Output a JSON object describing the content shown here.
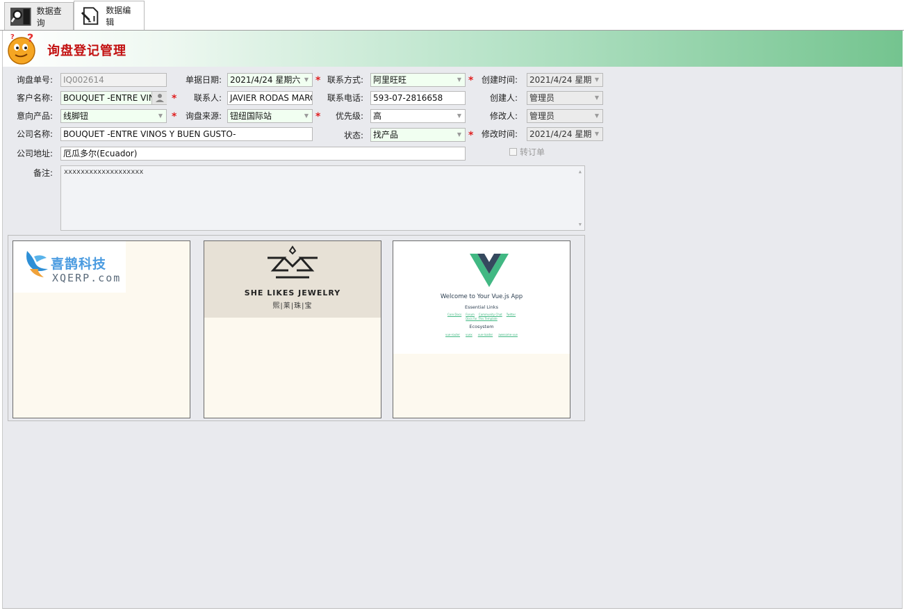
{
  "tabs": [
    {
      "label": "数据查询",
      "icon": "search-icon"
    },
    {
      "label": "数据编辑",
      "icon": "edit-document-icon"
    }
  ],
  "banner": {
    "title": "询盘登记管理"
  },
  "form": {
    "inquiry_no": {
      "label": "询盘单号:",
      "value": "IQ002614"
    },
    "doc_date": {
      "label": "单据日期:",
      "value": "2021/4/24 星期六"
    },
    "contact_method": {
      "label": "联系方式:",
      "value": "阿里旺旺"
    },
    "create_time": {
      "label": "创建时间:",
      "value": "2021/4/24 星期"
    },
    "customer": {
      "label": "客户名称:",
      "value": "BOUQUET -ENTRE VIN"
    },
    "contact_person": {
      "label": "联系人:",
      "value": "JAVIER RODAS MARC"
    },
    "contact_phone": {
      "label": "联系电话:",
      "value": "593-07-2816658"
    },
    "creator": {
      "label": "创建人:",
      "value": "管理员"
    },
    "product": {
      "label": "意向产品:",
      "value": "线脚钮"
    },
    "source": {
      "label": "询盘来源:",
      "value": "钮纽国际站"
    },
    "priority": {
      "label": "优先级:",
      "value": "高"
    },
    "modifier": {
      "label": "修改人:",
      "value": "管理员"
    },
    "company": {
      "label": "公司名称:",
      "value": "BOUQUET -ENTRE VINOS Y BUEN GUSTO-"
    },
    "status": {
      "label": "状态:",
      "value": "找产品"
    },
    "modify_time": {
      "label": "修改时间:",
      "value": "2021/4/24 星期"
    },
    "address": {
      "label": "公司地址:",
      "value": "厄瓜多尔(Ecuador)"
    },
    "convert_order": {
      "label": "转订单",
      "checked": false
    },
    "remark": {
      "label": "备注:",
      "value": "xxxxxxxxxxxxxxxxxxx"
    }
  },
  "images": [
    {
      "brand": "喜鹊科技",
      "sub": "XQERP.com"
    },
    {
      "brand": "SHE LIKES JEWELRY",
      "sub": "熙|莱|珠|宝"
    },
    {
      "title": "Welcome to Your Vue.js App",
      "section1": "Essential Links",
      "links1": [
        "Core Docs",
        "Forum",
        "Community Chat",
        "Twitter"
      ],
      "link_extra": "Docs for This Template",
      "section2": "Ecosystem",
      "links2": [
        "vue-router",
        "vuex",
        "vue-loader",
        "awesome-vue"
      ]
    }
  ]
}
